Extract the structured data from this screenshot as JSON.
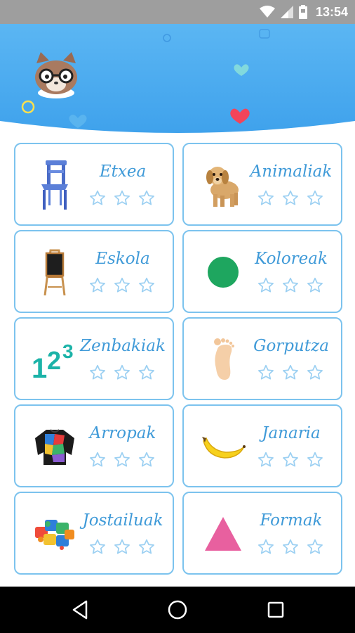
{
  "status_bar": {
    "time": "13:54"
  },
  "categories": [
    {
      "label": "Etxea",
      "icon": "chair-icon",
      "stars": 3
    },
    {
      "label": "Animaliak",
      "icon": "puppy-icon",
      "stars": 3
    },
    {
      "label": "Eskola",
      "icon": "chalkboard-icon",
      "stars": 3
    },
    {
      "label": "Koloreak",
      "icon": "green-circle-icon",
      "stars": 3
    },
    {
      "label": "Zenbakiak",
      "icon": "numbers-icon",
      "stars": 3,
      "icon_text": "123"
    },
    {
      "label": "Gorputza",
      "icon": "foot-icon",
      "stars": 3
    },
    {
      "label": "Arropak",
      "icon": "sweater-icon",
      "stars": 3
    },
    {
      "label": "Janaria",
      "icon": "banana-icon",
      "stars": 3
    },
    {
      "label": "Jostailuak",
      "icon": "puzzle-icon",
      "stars": 3
    },
    {
      "label": "Formak",
      "icon": "triangle-icon",
      "stars": 3
    }
  ],
  "colors": {
    "header_blue": "#4aa8ee",
    "card_border": "#7cc3ee",
    "label_blue": "#3f9ad8",
    "star_outline": "#9cd0f2"
  }
}
